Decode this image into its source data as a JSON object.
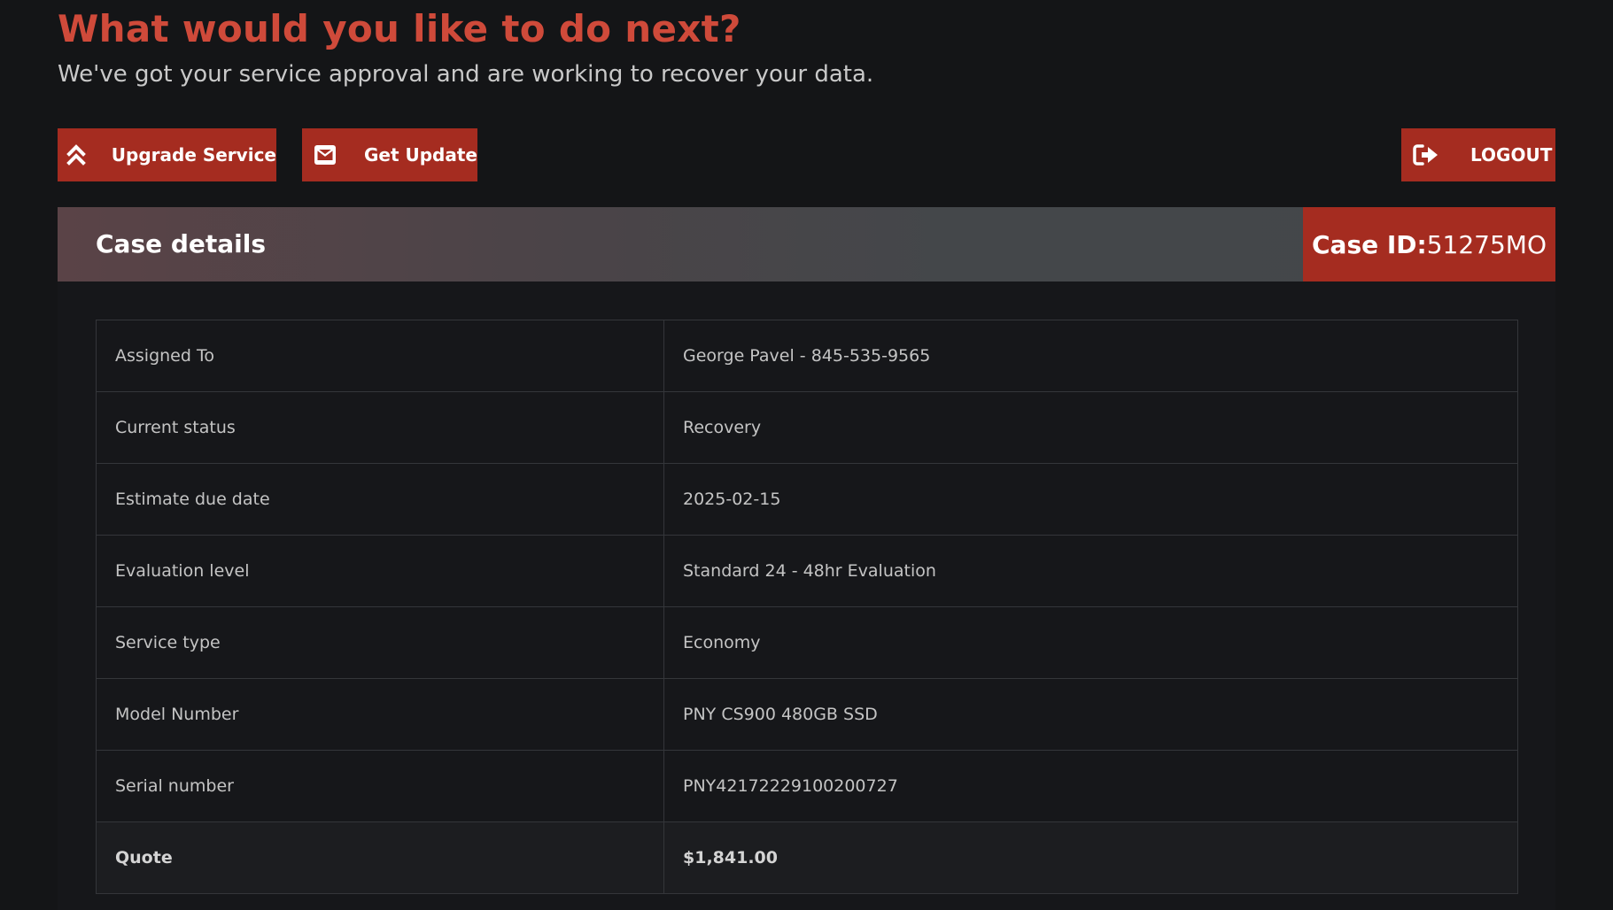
{
  "header": {
    "title": "What would you like to do next?",
    "subtitle": "We've got your service approval and are working to recover your data."
  },
  "actions": {
    "upgrade_label": "Upgrade Service",
    "update_label": "Get Update",
    "logout_label": "LOGOUT"
  },
  "case": {
    "title": "Case details",
    "id_label": "Case ID:",
    "id_value": "51275MO"
  },
  "details": [
    {
      "label": "Assigned To",
      "value": "George Pavel - 845-535-9565"
    },
    {
      "label": "Current status",
      "value": "Recovery"
    },
    {
      "label": "Estimate due date",
      "value": "2025-02-15"
    },
    {
      "label": "Evaluation level",
      "value": "Standard 24 - 48hr Evaluation"
    },
    {
      "label": "Service type",
      "value": "Economy"
    },
    {
      "label": "Model Number",
      "value": "PNY CS900 480GB SSD"
    },
    {
      "label": "Serial number",
      "value": "PNY42172229100200727"
    },
    {
      "label": "Quote",
      "value": "$1,841.00"
    }
  ],
  "icons": {
    "upgrade": "double-chevron-up-icon",
    "update": "envelope-icon",
    "logout": "sign-out-icon"
  },
  "colors": {
    "accent": "#a52c20",
    "heading": "#cf4a3a",
    "background": "#141517"
  }
}
